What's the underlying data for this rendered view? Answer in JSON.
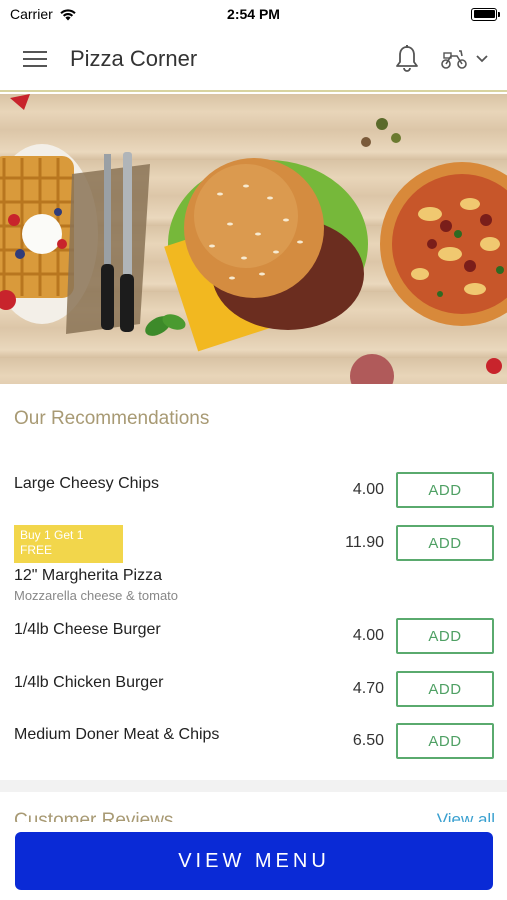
{
  "status_bar": {
    "carrier": "Carrier",
    "time": "2:54 PM"
  },
  "header": {
    "title": "Pizza Corner",
    "icons": {
      "menu": "hamburger-menu-icon",
      "notifications": "bell-icon",
      "delivery": "scooter-icon",
      "dropdown": "chevron-down-icon"
    }
  },
  "hero": {
    "description": "food banner image with waffles, fork and knife, burger, pizza on wooden table"
  },
  "recommendations": {
    "title": "Our Recommendations",
    "items": [
      {
        "name": "Large Cheesy Chips",
        "price": "4.00",
        "add_label": "ADD"
      },
      {
        "name": "12\" Margherita Pizza",
        "description": "Mozzarella cheese & tomato",
        "badge": "Buy 1 Get 1 FREE",
        "price": "11.90",
        "add_label": "ADD"
      },
      {
        "name": "1/4lb Cheese Burger",
        "price": "4.00",
        "add_label": "ADD"
      },
      {
        "name": "1/4lb Chicken Burger",
        "price": "4.70",
        "add_label": "ADD"
      },
      {
        "name": "Medium Doner Meat & Chips",
        "price": "6.50",
        "add_label": "ADD"
      }
    ]
  },
  "reviews": {
    "title": "Customer Reviews",
    "view_all": "View all"
  },
  "footer": {
    "button_label": "VIEW MENU"
  },
  "colors": {
    "accent_blue": "#0a2ad6",
    "add_green": "#4fa064",
    "section_title": "#a89a74",
    "badge_yellow": "#f2d64b"
  }
}
